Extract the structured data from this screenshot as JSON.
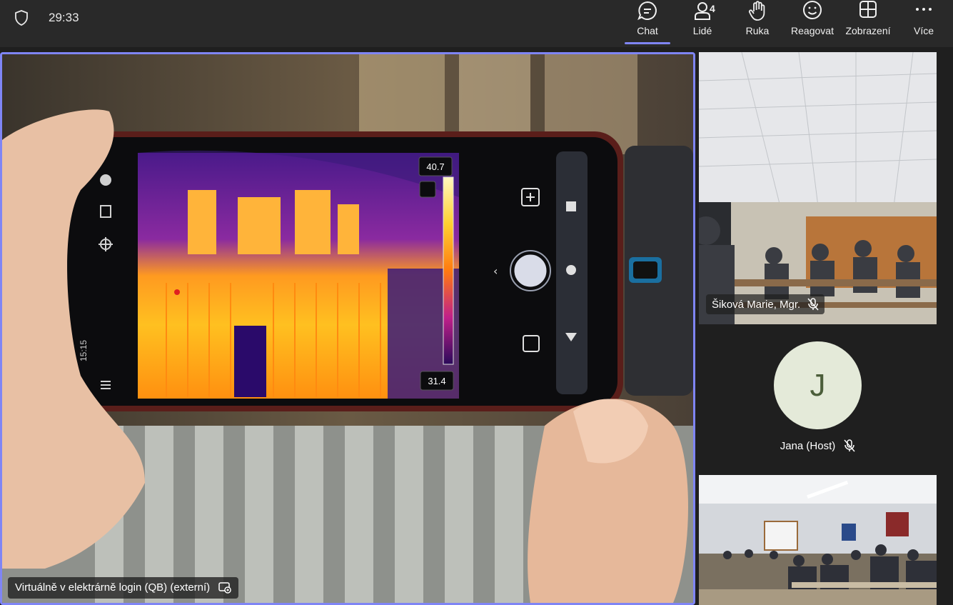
{
  "meeting": {
    "timer": "29:33"
  },
  "toolbar": {
    "chat_label": "Chat",
    "people_label": "Lidé",
    "people_count": "4",
    "hand_label": "Ruka",
    "react_label": "Reagovat",
    "view_label": "Zobrazení",
    "more_label": "Více",
    "accent_color": "#7f85f5"
  },
  "stage": {
    "participant_name": "Virtuálně v elektrárně login (QB) (externí)",
    "phone": {
      "scale_max": "40.7",
      "scale_min": "31.4",
      "status_time": "15:15"
    }
  },
  "participants": [
    {
      "name": "Šiková Marie, Mgr.",
      "muted": true
    },
    {
      "name": "Jana (Host)",
      "initial": "J",
      "muted": true
    }
  ]
}
